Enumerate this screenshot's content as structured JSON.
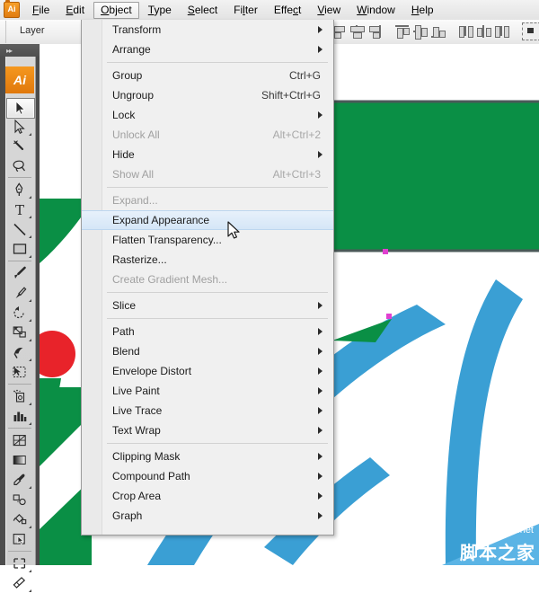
{
  "app": {
    "name": "Adobe Illustrator",
    "logo_text": "Ai",
    "accent_color": "#e8820c"
  },
  "menubar": {
    "items": [
      {
        "label": "File",
        "active": false
      },
      {
        "label": "Edit",
        "active": false
      },
      {
        "label": "Object",
        "active": true
      },
      {
        "label": "Type",
        "active": false
      },
      {
        "label": "Select",
        "active": false
      },
      {
        "label": "Filter",
        "active": false
      },
      {
        "label": "Effect",
        "active": false
      },
      {
        "label": "View",
        "active": false
      },
      {
        "label": "Window",
        "active": false
      },
      {
        "label": "Help",
        "active": false
      }
    ]
  },
  "controlbar": {
    "layer_label": "Layer"
  },
  "object_menu": {
    "title": "Object",
    "items": [
      {
        "label": "Transform",
        "shortcut": "",
        "submenu": true,
        "disabled": false,
        "highlighted": false
      },
      {
        "label": "Arrange",
        "shortcut": "",
        "submenu": true,
        "disabled": false,
        "highlighted": false
      },
      {
        "separator": true
      },
      {
        "label": "Group",
        "shortcut": "Ctrl+G",
        "submenu": false,
        "disabled": false,
        "highlighted": false
      },
      {
        "label": "Ungroup",
        "shortcut": "Shift+Ctrl+G",
        "submenu": false,
        "disabled": false,
        "highlighted": false
      },
      {
        "label": "Lock",
        "shortcut": "",
        "submenu": true,
        "disabled": false,
        "highlighted": false
      },
      {
        "label": "Unlock All",
        "shortcut": "Alt+Ctrl+2",
        "submenu": false,
        "disabled": true,
        "highlighted": false
      },
      {
        "label": "Hide",
        "shortcut": "",
        "submenu": true,
        "disabled": false,
        "highlighted": false
      },
      {
        "label": "Show All",
        "shortcut": "Alt+Ctrl+3",
        "submenu": false,
        "disabled": true,
        "highlighted": false
      },
      {
        "separator": true
      },
      {
        "label": "Expand...",
        "shortcut": "",
        "submenu": false,
        "disabled": true,
        "highlighted": false
      },
      {
        "label": "Expand Appearance",
        "shortcut": "",
        "submenu": false,
        "disabled": false,
        "highlighted": true
      },
      {
        "label": "Flatten Transparency...",
        "shortcut": "",
        "submenu": false,
        "disabled": false,
        "highlighted": false
      },
      {
        "label": "Rasterize...",
        "shortcut": "",
        "submenu": false,
        "disabled": false,
        "highlighted": false
      },
      {
        "label": "Create Gradient Mesh...",
        "shortcut": "",
        "submenu": false,
        "disabled": true,
        "highlighted": false
      },
      {
        "separator": true
      },
      {
        "label": "Slice",
        "shortcut": "",
        "submenu": true,
        "disabled": false,
        "highlighted": false
      },
      {
        "separator": true
      },
      {
        "label": "Path",
        "shortcut": "",
        "submenu": true,
        "disabled": false,
        "highlighted": false
      },
      {
        "label": "Blend",
        "shortcut": "",
        "submenu": true,
        "disabled": false,
        "highlighted": false
      },
      {
        "label": "Envelope Distort",
        "shortcut": "",
        "submenu": true,
        "disabled": false,
        "highlighted": false
      },
      {
        "label": "Live Paint",
        "shortcut": "",
        "submenu": true,
        "disabled": false,
        "highlighted": false
      },
      {
        "label": "Live Trace",
        "shortcut": "",
        "submenu": true,
        "disabled": false,
        "highlighted": false
      },
      {
        "label": "Text Wrap",
        "shortcut": "",
        "submenu": true,
        "disabled": false,
        "highlighted": false
      },
      {
        "separator": true
      },
      {
        "label": "Clipping Mask",
        "shortcut": "",
        "submenu": true,
        "disabled": false,
        "highlighted": false
      },
      {
        "label": "Compound Path",
        "shortcut": "",
        "submenu": true,
        "disabled": false,
        "highlighted": false
      },
      {
        "label": "Crop Area",
        "shortcut": "",
        "submenu": true,
        "disabled": false,
        "highlighted": false
      },
      {
        "label": "Graph",
        "shortcut": "",
        "submenu": true,
        "disabled": false,
        "highlighted": false
      }
    ]
  },
  "tools": {
    "items": [
      {
        "name": "selection-tool",
        "selected": true,
        "flyout": false
      },
      {
        "name": "direct-selection-tool",
        "selected": false,
        "flyout": true
      },
      {
        "name": "magic-wand-tool",
        "selected": false,
        "flyout": false
      },
      {
        "name": "lasso-tool",
        "selected": false,
        "flyout": false
      },
      {
        "name": "pen-tool",
        "selected": false,
        "flyout": true
      },
      {
        "name": "type-tool",
        "selected": false,
        "flyout": true
      },
      {
        "name": "line-segment-tool",
        "selected": false,
        "flyout": true
      },
      {
        "name": "rectangle-tool",
        "selected": false,
        "flyout": true
      },
      {
        "name": "paintbrush-tool",
        "selected": false,
        "flyout": false
      },
      {
        "name": "pencil-tool",
        "selected": false,
        "flyout": true
      },
      {
        "name": "rotate-tool",
        "selected": false,
        "flyout": true
      },
      {
        "name": "scale-tool",
        "selected": false,
        "flyout": true
      },
      {
        "name": "warp-tool",
        "selected": false,
        "flyout": true
      },
      {
        "name": "free-transform-tool",
        "selected": false,
        "flyout": false
      },
      {
        "name": "symbol-sprayer-tool",
        "selected": false,
        "flyout": true
      },
      {
        "name": "column-graph-tool",
        "selected": false,
        "flyout": true
      },
      {
        "name": "mesh-tool",
        "selected": false,
        "flyout": false
      },
      {
        "name": "gradient-tool",
        "selected": false,
        "flyout": false
      },
      {
        "name": "eyedropper-tool",
        "selected": false,
        "flyout": true
      },
      {
        "name": "blend-tool",
        "selected": false,
        "flyout": false
      },
      {
        "name": "live-paint-bucket-tool",
        "selected": false,
        "flyout": true
      },
      {
        "name": "live-paint-selection-tool",
        "selected": false,
        "flyout": false
      },
      {
        "name": "crop-area-tool",
        "selected": false,
        "flyout": true
      },
      {
        "name": "eraser-tool",
        "selected": false,
        "flyout": true
      }
    ]
  },
  "artwork": {
    "green_color": "#0a8f45",
    "red_color": "#e8232a",
    "blue_color": "#3a9fd4",
    "rect_stroke_color": "#4a5a58",
    "anchor_color": "#e040d0"
  },
  "watermark": {
    "english": "jb51.net",
    "chinese": "脚本之家",
    "color": "#5bb4e5"
  }
}
